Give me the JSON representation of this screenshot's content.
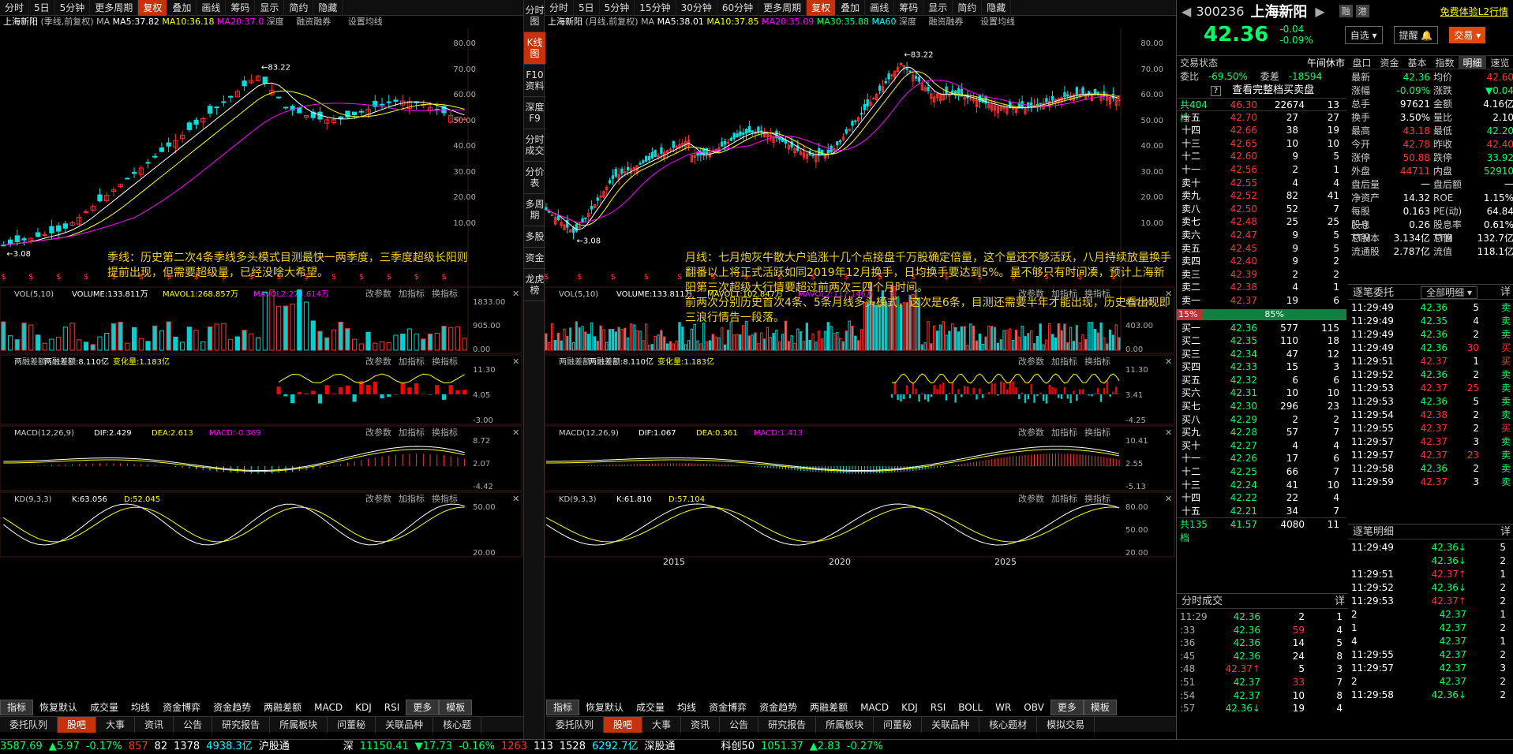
{
  "left_panel": {
    "toolbar": [
      "分时",
      "5日",
      "5分钟",
      "更多周期",
      "复权",
      "叠加",
      "画线",
      "筹码",
      "显示",
      "简约",
      "隐藏"
    ],
    "toolbar_active": "复权",
    "header": {
      "name": "上海新阳",
      "period": "(季线,前复权)",
      "ma_label": "MA",
      "ma5": "MA5:37.82",
      "ma10": "MA10:36.18",
      "ma20": "MA20:37.0",
      "deep": "深度",
      "margin": "融资融券",
      "settings": "设置均线"
    },
    "price_axis": [
      "80.00",
      "70.00",
      "60.00",
      "50.00",
      "40.00",
      "30.00",
      "20.00",
      "10.00"
    ],
    "high_label": "83.22",
    "low_label": "3.08",
    "note": "季线：历史第二次4条季线多头模式目测最快一两季度，三季度超级长阳则提前出现，但需要超级量，已经没啥大希望。",
    "vol": {
      "title": "VOL(5,10)",
      "volume": "VOLUME:133.811万",
      "mavol1": "MAVOL1:268.857万",
      "mavol2": "MAVOL2:274.614万",
      "axis": [
        "1833.00",
        "905.00",
        "0.00"
      ]
    },
    "rz": {
      "title": "两融差额",
      "val": "两融差额:8.110亿",
      "chg": "变化量:1.183亿",
      "axis": [
        "11.30",
        "4.05",
        "-3.00"
      ]
    },
    "macd": {
      "title": "MACD(12,26,9)",
      "dif": "DIF:2.429",
      "dea": "DEA:2.613",
      "macd": "MACD:-0.369",
      "axis": [
        "8.72",
        "2.07",
        "-4.42"
      ]
    },
    "kd": {
      "title": "KD(9,3,3)",
      "k": "K:63.056",
      "d": "D:52.045",
      "axis": [
        "50.00",
        "20.00"
      ]
    },
    "controls": [
      "改参数",
      "加指标",
      "换指标"
    ],
    "bottom_tabs": [
      "指标",
      "恢复默认",
      "成交量",
      "均线",
      "资金博弈",
      "资金趋势",
      "两融差额",
      "MACD",
      "KDJ",
      "RSI",
      "更多",
      "模板"
    ],
    "bottom_tabs2": [
      "委托队列",
      "股吧",
      "大事",
      "资讯",
      "公告",
      "研究报告",
      "所属板块",
      "问董秘",
      "关联品种",
      "核心题"
    ]
  },
  "vertical_tabs": [
    "分时图",
    "K线图",
    "F10资料",
    "深度F9",
    "分时成交",
    "分价表",
    "多周期",
    "多股",
    "资金",
    "龙虎榜"
  ],
  "mid_panel": {
    "toolbar": [
      "分时",
      "5日",
      "5分钟",
      "15分钟",
      "30分钟",
      "60分钟",
      "更多周期",
      "复权",
      "叠加",
      "画线",
      "筹码",
      "显示",
      "简约",
      "隐藏"
    ],
    "toolbar_active": "复权",
    "header": {
      "name": "上海新阳",
      "period": "(月线,前复权)",
      "ma_label": "MA",
      "ma5": "MA5:38.01",
      "ma10": "MA10:37.85",
      "ma20": "MA20:35.09",
      "ma30": "MA30:35.88",
      "ma60": "MA60",
      "deep": "深度",
      "margin": "融资融券",
      "settings": "设置均线"
    },
    "price_axis": [
      "80.00",
      "70.00",
      "60.00",
      "50.00",
      "40.00",
      "30.00",
      "20.00",
      "10.00"
    ],
    "high_label": "83.22",
    "low_label": "3.08",
    "note": "月线：七月炮灰牛散大户追涨十几个点接盘千万股确定倍量，这个量还不够活跃，八月持续放量换手翻番以上将正式活跃如同2019年12月换手，日均换手要达到5%。量不够只有时间凑，预计上海新阳第三次超级大行情要超过前两次三四个月时间。",
    "note2": "前两次分别历史首次4条、5条月线多头模式，这次是6条，目测还需要半年才能出现，历史看出现即三浪行情告一段落。",
    "vol": {
      "title": "VOL(5,10)",
      "volume": "VOLUME:133.811万",
      "mavol1": "MAVOL1:102.847万",
      "mavol2": "MAVOL2:117.146万",
      "axis": [
        "815.00",
        "403.00",
        "0.00"
      ]
    },
    "rz": {
      "title": "两融差额",
      "val": "两融差额:8.110亿",
      "chg": "变化量:1.183亿",
      "axis": [
        "11.30",
        "3.41",
        "-4.25"
      ]
    },
    "macd": {
      "title": "MACD(12,26,9)",
      "dif": "DIF:1.067",
      "dea": "DEA:0.361",
      "macd": "MACD:1.413",
      "axis": [
        "10.41",
        "2.55",
        "-5.13"
      ]
    },
    "kd": {
      "title": "KD(9,3,3)",
      "k": "K:61.810",
      "d": "D:57.104",
      "axis": [
        "80.00",
        "50.00",
        "20.00"
      ]
    },
    "years": [
      "2015",
      "2020",
      "2025"
    ],
    "controls": [
      "改参数",
      "加指标",
      "换指标"
    ],
    "bottom_tabs": [
      "指标",
      "恢复默认",
      "成交量",
      "均线",
      "资金博弈",
      "资金趋势",
      "两融差额",
      "MACD",
      "KDJ",
      "RSI",
      "BOLL",
      "WR",
      "OBV",
      "更多",
      "模板"
    ],
    "bottom_tabs2": [
      "委托队列",
      "股吧",
      "大事",
      "资讯",
      "公告",
      "研究报告",
      "所属板块",
      "问董秘",
      "关联品种",
      "核心题材",
      "模拟交易"
    ]
  },
  "right_panel": {
    "code": "300236",
    "name": "上海新阳",
    "tag1": "融",
    "tag2": "港",
    "free": "免费体验L2行情",
    "price": "42.36",
    "chg": "-0.04",
    "pct": "-0.09%",
    "btn_zixuan": "自选",
    "btn_tixing": "提醒",
    "btn_jiaoyi": "交易",
    "tabs": [
      "盘口",
      "资金",
      "基本",
      "指数",
      "明细",
      "速览"
    ],
    "trade_status_label": "交易状态",
    "trade_status": "午间休市",
    "weibi": "委比",
    "weibi_val": "-69.50%",
    "weicha": "委差",
    "weicha_val": "-18594",
    "full_book": "查看完整档买卖盘",
    "total_ask": "共404档",
    "total_ask_price": "46.30",
    "total_ask_vol": "22674",
    "total_ask_n": "13",
    "asks": [
      [
        "十五",
        "42.70",
        "27",
        "27"
      ],
      [
        "十四",
        "42.66",
        "38",
        "19"
      ],
      [
        "十三",
        "42.65",
        "10",
        "10"
      ],
      [
        "十二",
        "42.60",
        "9",
        "5"
      ],
      [
        "十一",
        "42.56",
        "2",
        "1"
      ],
      [
        "卖十",
        "42.55",
        "4",
        "4"
      ],
      [
        "卖九",
        "42.52",
        "82",
        "41"
      ],
      [
        "卖八",
        "42.50",
        "52",
        "7"
      ],
      [
        "卖七",
        "42.48",
        "25",
        "25"
      ],
      [
        "卖六",
        "42.47",
        "9",
        "5"
      ],
      [
        "卖五",
        "42.45",
        "9",
        "5"
      ],
      [
        "卖四",
        "42.40",
        "9",
        "2"
      ],
      [
        "卖三",
        "42.39",
        "2",
        "2"
      ],
      [
        "卖二",
        "42.38",
        "4",
        "1"
      ],
      [
        "卖一",
        "42.37",
        "19",
        "6"
      ]
    ],
    "ratio_left": "15%",
    "ratio_right": "85%",
    "bids": [
      [
        "买一",
        "42.36",
        "577",
        "115"
      ],
      [
        "买二",
        "42.35",
        "110",
        "18"
      ],
      [
        "买三",
        "42.34",
        "47",
        "12"
      ],
      [
        "买四",
        "42.33",
        "15",
        "3"
      ],
      [
        "买五",
        "42.32",
        "6",
        "6"
      ],
      [
        "买六",
        "42.31",
        "10",
        "10"
      ],
      [
        "买七",
        "42.30",
        "296",
        "23"
      ],
      [
        "买八",
        "42.29",
        "2",
        "2"
      ],
      [
        "买九",
        "42.28",
        "57",
        "7"
      ],
      [
        "买十",
        "42.27",
        "4",
        "4"
      ],
      [
        "十一",
        "42.26",
        "17",
        "6"
      ],
      [
        "十二",
        "42.25",
        "66",
        "7"
      ],
      [
        "十三",
        "42.24",
        "41",
        "10"
      ],
      [
        "十四",
        "42.22",
        "22",
        "4"
      ],
      [
        "十五",
        "42.21",
        "34",
        "7"
      ]
    ],
    "total_bid": "共135档",
    "total_bid_price": "41.57",
    "total_bid_vol": "4080",
    "total_bid_n": "11",
    "kv": [
      [
        "最新",
        "42.36",
        "均价",
        "42.60"
      ],
      [
        "涨幅",
        "-0.09%",
        "涨跌",
        "▼0.04"
      ],
      [
        "总手",
        "97621",
        "金额",
        "4.16亿"
      ],
      [
        "换手",
        "3.50%",
        "量比",
        "2.10"
      ],
      [
        "最高",
        "43.18",
        "最低",
        "42.20"
      ],
      [
        "今开",
        "42.78",
        "昨收",
        "42.40"
      ],
      [
        "涨停",
        "50.88",
        "跌停",
        "33.92"
      ],
      [
        "外盘",
        "44711",
        "内盘",
        "52910"
      ],
      [
        "盘后量",
        "一",
        "盘后额",
        "一"
      ],
      [
        "净资产",
        "14.32",
        "ROE",
        "1.15%"
      ],
      [
        "每股(一)",
        "0.163",
        "PE(动)",
        "64.84"
      ],
      [
        "股息TTM",
        "0.26",
        "股息率TTM",
        "0.61%"
      ],
      [
        "总股本",
        "3.134亿",
        "总值",
        "132.7亿"
      ],
      [
        "流通股",
        "2.787亿",
        "流值",
        "118.1亿"
      ]
    ],
    "zhubi_title": "逐笔委托",
    "zhubi_filter": "全部明细",
    "zhubi_btn": "详",
    "zhubi": [
      [
        "11:29:49",
        "42.36",
        "5",
        "卖"
      ],
      [
        "11:29:49",
        "42.35",
        "4",
        "卖"
      ],
      [
        "11:29:49",
        "42.36",
        "2",
        "卖"
      ],
      [
        "11:29:49",
        "42.36",
        "30",
        "买"
      ],
      [
        "11:29:51",
        "42.37",
        "1",
        "买"
      ],
      [
        "11:29:52",
        "42.36",
        "2",
        "卖"
      ],
      [
        "11:29:53",
        "42.37",
        "25",
        "卖"
      ],
      [
        "11:29:53",
        "42.36",
        "5",
        "卖"
      ],
      [
        "11:29:54",
        "42.38",
        "2",
        "卖"
      ],
      [
        "11:29:55",
        "42.37",
        "2",
        "买"
      ],
      [
        "11:29:57",
        "42.37",
        "3",
        "卖"
      ],
      [
        "11:29:57",
        "42.37",
        "23",
        "卖"
      ],
      [
        "11:29:58",
        "42.36",
        "2",
        "卖"
      ],
      [
        "11:29:59",
        "42.37",
        "3",
        "卖"
      ]
    ],
    "fenshi_title": "分时成交",
    "fenshi_btn": "详",
    "fenshi": [
      [
        "11:29",
        "42.36",
        "2",
        "1"
      ],
      [
        ":33",
        "42.36",
        "59",
        "4"
      ],
      [
        ":36",
        "42.36",
        "14",
        "5"
      ],
      [
        ":45",
        "42.36",
        "24",
        "8"
      ],
      [
        ":48",
        "42.37↑",
        "5",
        "3"
      ],
      [
        ":51",
        "42.37",
        "33",
        "7"
      ],
      [
        ":54",
        "42.37",
        "10",
        "8"
      ],
      [
        ":57",
        "42.36↓",
        "19",
        "4"
      ]
    ],
    "mingxi_title": "逐笔明细",
    "mingxi_btn": "详",
    "mingxi": [
      [
        "11:29:49",
        "42.36↓",
        "5"
      ],
      [
        "",
        "42.36↓",
        "2"
      ],
      [
        "11:29:51",
        "42.37↑",
        "1"
      ],
      [
        "11:29:52",
        "42.36↓",
        "2"
      ],
      [
        "11:29:53",
        "42.37↑",
        "2"
      ],
      [
        "2",
        "42.37",
        "1"
      ],
      [
        "1",
        "42.37",
        "2"
      ],
      [
        "4",
        "42.37",
        "1"
      ],
      [
        "11:29:55",
        "42.37",
        "2"
      ],
      [
        "11:29:57",
        "42.37",
        "3"
      ],
      [
        "2",
        "42.37",
        "2"
      ],
      [
        "11:29:58",
        "42.36↓",
        "2"
      ]
    ]
  },
  "status_bar": {
    "sh": "3587.69",
    "sh_chg": "▲5.97",
    "sh_pct": "-0.17%",
    "sh_up": "857",
    "sh_eq": "82",
    "sh_dn": "1378",
    "sh_amt": "4938.3亿",
    "hgt": "沪股通",
    "sz_label": "深",
    "sz": "11150.41",
    "sz_chg": "▼17.73",
    "sz_pct": "-0.16%",
    "sz_up": "1263",
    "sz_eq": "113",
    "sz_dn": "1528",
    "sz_amt": "6292.7亿",
    "sgt": "深股通",
    "kc": "科创50",
    "kc_val": "1051.37",
    "kc_chg": "▲2.83",
    "kc_pct": "-0.27%"
  }
}
